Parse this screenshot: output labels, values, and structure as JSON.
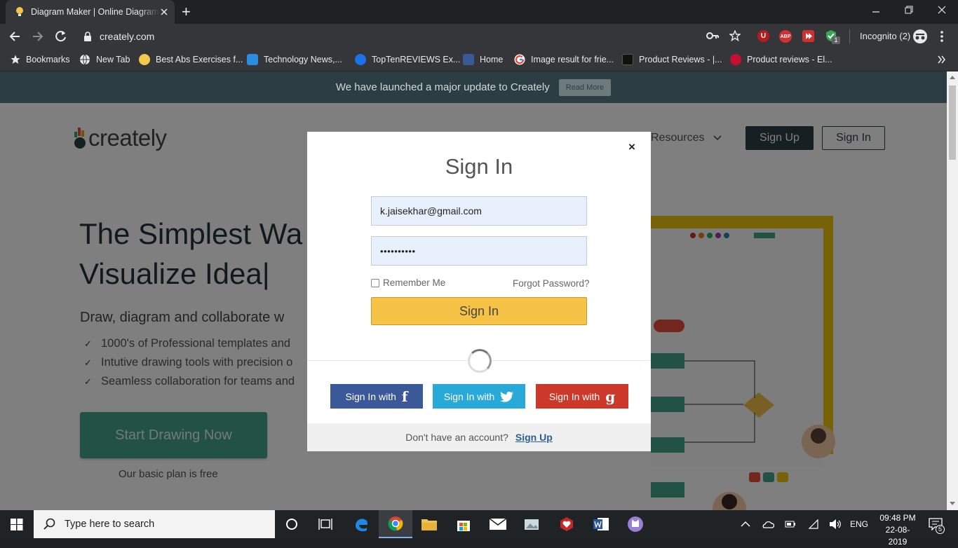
{
  "browser": {
    "tab_title": "Diagram Maker | Online Diagram Software",
    "new_tab_symbol": "+",
    "url": "creately.com",
    "incognito_label": "Incognito (2)",
    "extension_badge": "1",
    "extensions": [
      "U",
      "ABP"
    ]
  },
  "bookmarks": [
    {
      "label": "Bookmarks",
      "icon": "star-icon",
      "color": "#ffffff"
    },
    {
      "label": "New Tab",
      "icon": "globe-icon",
      "color": "#e8eaed"
    },
    {
      "label": "Best Abs Exercises f...",
      "icon": "abs-site-icon",
      "color": "#f2c94c"
    },
    {
      "label": "Technology News,...",
      "icon": "tech-news-icon",
      "color": "#2b8de0"
    },
    {
      "label": "TopTenREVIEWS Ex...",
      "icon": "toptenreviews-icon",
      "color": "#1a73e8"
    },
    {
      "label": "Home",
      "icon": "facebook-icon",
      "color": "#3b5998"
    },
    {
      "label": "Image result for frie...",
      "icon": "google-icon",
      "color": "#ffffff"
    },
    {
      "label": "Product Reviews - |...",
      "icon": "product-reviews-icon",
      "color": "#111111"
    },
    {
      "label": "Product reviews - El...",
      "icon": "cnet-icon",
      "color": "#c8102e"
    }
  ],
  "page": {
    "banner_text": "We have launched a major update to Creately",
    "banner_button": "Read More",
    "logo": "creately",
    "nav_resources": "Resources",
    "nav_signup": "Sign Up",
    "nav_signin": "Sign In",
    "hero_line1": "The Simplest Wa",
    "hero_line2": "Visualize Idea|",
    "hero_sub": "Draw, diagram and collaborate w",
    "features": [
      "1000's of Professional templates and",
      "Intutive drawing tools with precision o",
      "Seamless collaboration for teams and"
    ],
    "start_button": "Start Drawing Now",
    "plan_note": "Our basic plan is free"
  },
  "modal": {
    "title": "Sign In",
    "close": "×",
    "email_value": "k.jaisekhar@gmail.com",
    "password_value": "••••••••••",
    "remember_label": "Remember Me",
    "remember_checked": false,
    "forgot_label": "Forgot Password?",
    "signin_button": "Sign In",
    "social": [
      {
        "label": "Sign In with",
        "icon": "f",
        "color": "#3b5998"
      },
      {
        "label": "Sign In with",
        "icon": "twitter-bird",
        "color": "#29a9d8"
      },
      {
        "label": "Sign In with",
        "icon": "g",
        "color": "#cc3829"
      }
    ],
    "footer_text": "Don't have an account?",
    "footer_link": "Sign Up"
  },
  "taskbar": {
    "search_placeholder": "Type here to search",
    "language": "ENG",
    "time": "09:48 PM",
    "date": "22-08-2019",
    "notification_count": "5"
  },
  "colors": {
    "accent_green": "#43a488",
    "signin_yellow": "#f6c347",
    "banner": "#2c3e44"
  }
}
